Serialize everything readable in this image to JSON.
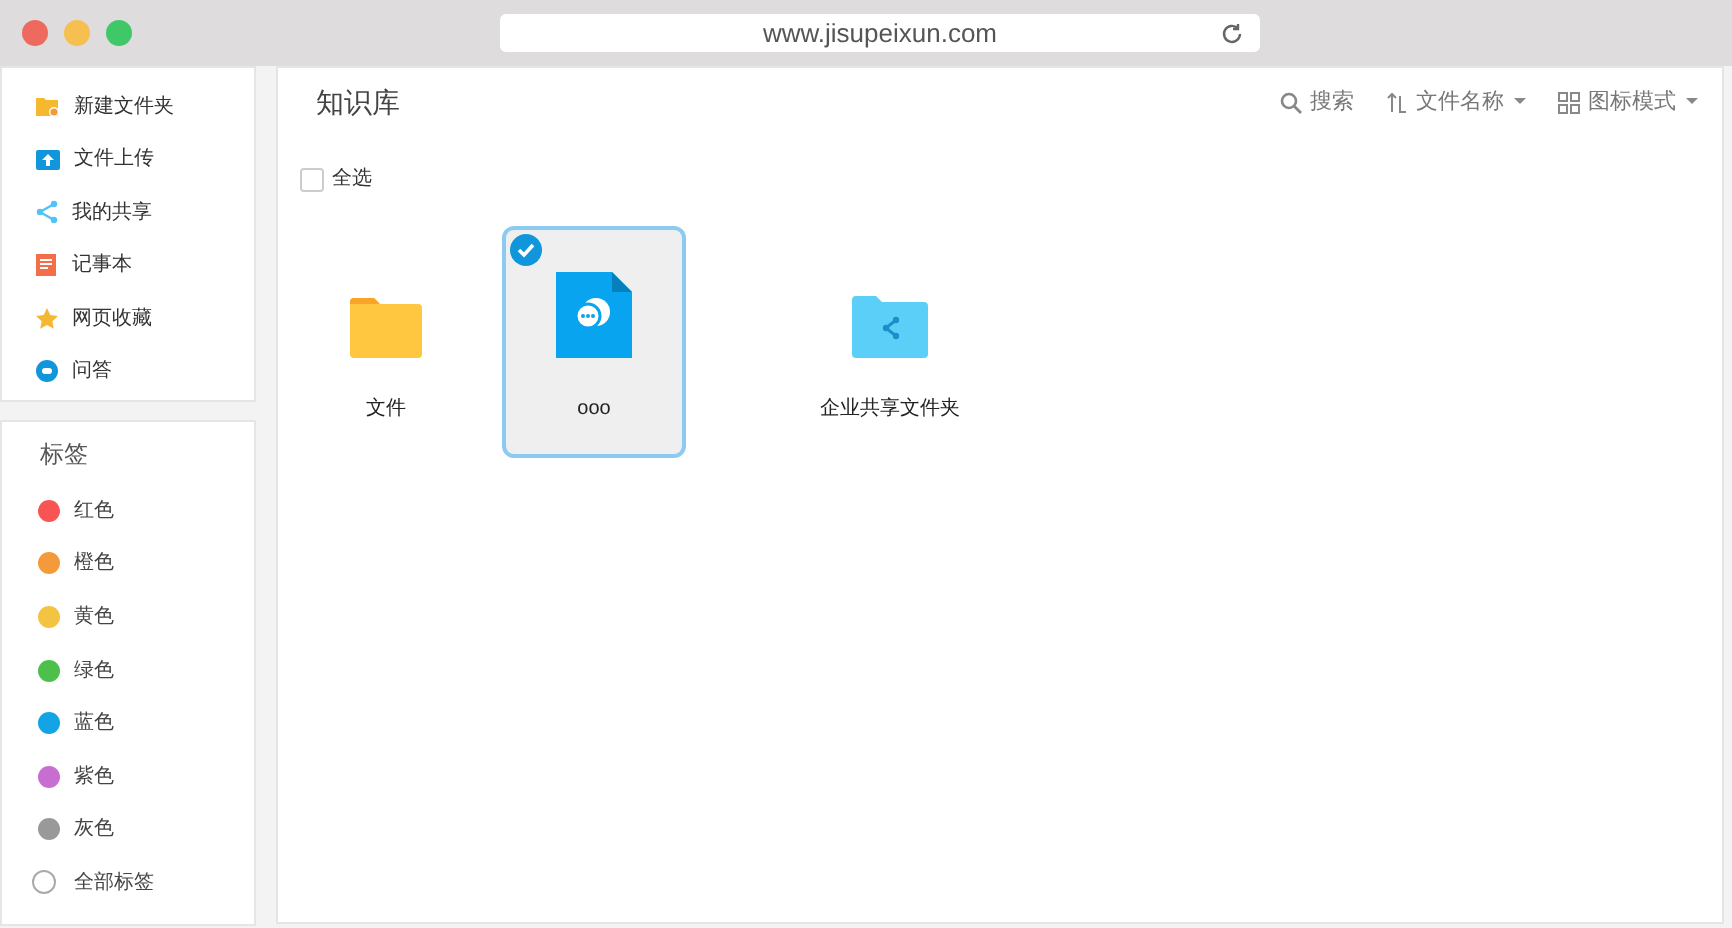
{
  "window": {
    "url": "www.jisupeixun.com"
  },
  "sidebar": {
    "actions": [
      {
        "label": "新建文件夹",
        "kind": "new-folder"
      },
      {
        "label": "文件上传",
        "kind": "upload"
      },
      {
        "label": "我的共享",
        "kind": "share"
      },
      {
        "label": "记事本",
        "kind": "note"
      },
      {
        "label": "网页收藏",
        "kind": "star"
      },
      {
        "label": "问答",
        "kind": "qa"
      }
    ],
    "tags_title": "标签",
    "tags": [
      {
        "label": "红色",
        "color": "#f85454"
      },
      {
        "label": "橙色",
        "color": "#f59a3b"
      },
      {
        "label": "黄色",
        "color": "#f3c341"
      },
      {
        "label": "绿色",
        "color": "#4cc04b"
      },
      {
        "label": "蓝色",
        "color": "#14a4e6"
      },
      {
        "label": "紫色",
        "color": "#c86ed0"
      },
      {
        "label": "灰色",
        "color": "#999999"
      },
      {
        "label": "全部标签"
      }
    ]
  },
  "main": {
    "title": "知识库",
    "toolbar": [
      "搜索",
      "文件名称",
      "图标模式"
    ],
    "select_all": {
      "label": "全选",
      "checked": false
    },
    "items": [
      {
        "name": "文件",
        "kind": "folder",
        "selected": false
      },
      {
        "name": "ooo",
        "kind": "document",
        "selected": true
      },
      {
        "name": "企业共享文件夹",
        "kind": "shared-folder",
        "selected": false
      }
    ]
  }
}
